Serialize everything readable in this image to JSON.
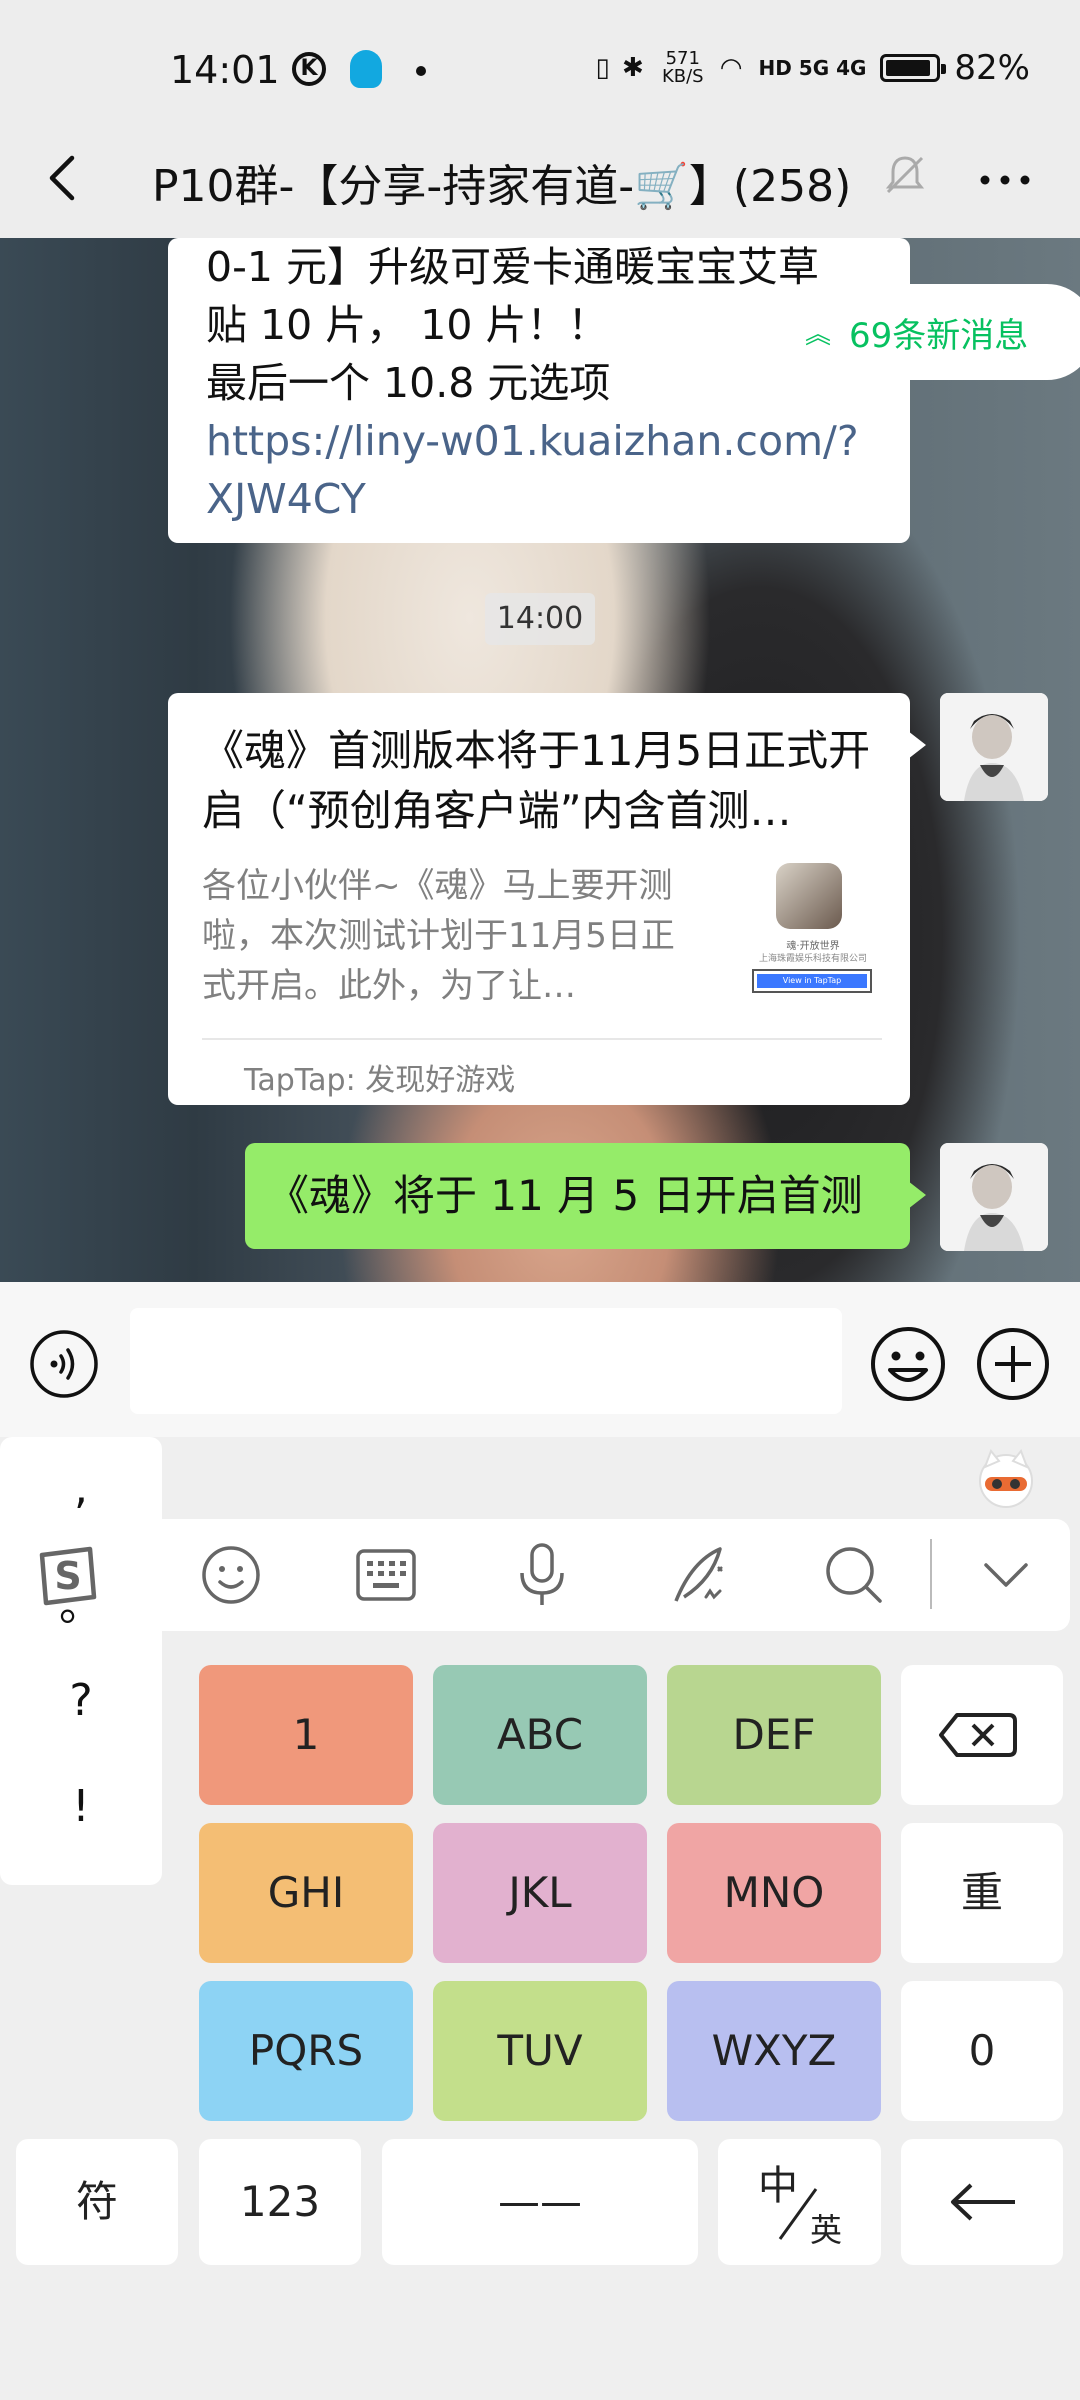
{
  "status_bar": {
    "time": "14:01",
    "k_badge": "K",
    "speed": "571 KB/S",
    "network": "HD 5G 4G",
    "battery": "82%"
  },
  "header": {
    "title": "P10群-【分享-持家有道-🛒】(258)"
  },
  "chat": {
    "msg1_lines": [
      "0-1 元】升级可爱卡通暖宝宝艾草",
      "贴 10 片，  10 片！！",
      "最后一个 10.8 元选项"
    ],
    "msg1_link": "https://liny-w01.kuaizhan.com/?XJW4CY",
    "new_messages": "69条新消息",
    "time_chip": "14:00",
    "card": {
      "title": "《魂》首测版本将于11月5日正式开启（“预创角客户端”内含首测…",
      "desc": "各位小伙伴~《魂》马上要开测啦，本次测试计划于11月5日正式开启。此外，为了让…",
      "thumb_caption": "魂·开放世界",
      "thumb_company": "上海珠霞娱乐科技有限公司",
      "thumb_button": "View in TapTap",
      "source": "TapTap: 发现好游戏"
    },
    "green_msg": "《魂》将于 11 月 5 日开启首测"
  },
  "keyboard": {
    "punct": [
      ",",
      "。",
      "?",
      "!"
    ],
    "keys": {
      "k1": "1",
      "abc": "ABC",
      "def": "DEF",
      "ghi": "GHI",
      "jkl": "JKL",
      "mno": "MNO",
      "pqrs": "PQRS",
      "tuv": "TUV",
      "wxyz": "WXYZ",
      "chong": "重",
      "zero": "0",
      "fu": "符",
      "num": "123",
      "space": "——",
      "zh": "中",
      "en": "英"
    },
    "colors": {
      "k1": "#f0987b",
      "abc": "#97c9b4",
      "def": "#b8d690",
      "ghi": "#f4be74",
      "jkl": "#e2b1cf",
      "mno": "#f0a5a4",
      "pqrs": "#8dd3f4",
      "tuv": "#c3df8b",
      "wxyz": "#b8bff0"
    }
  }
}
